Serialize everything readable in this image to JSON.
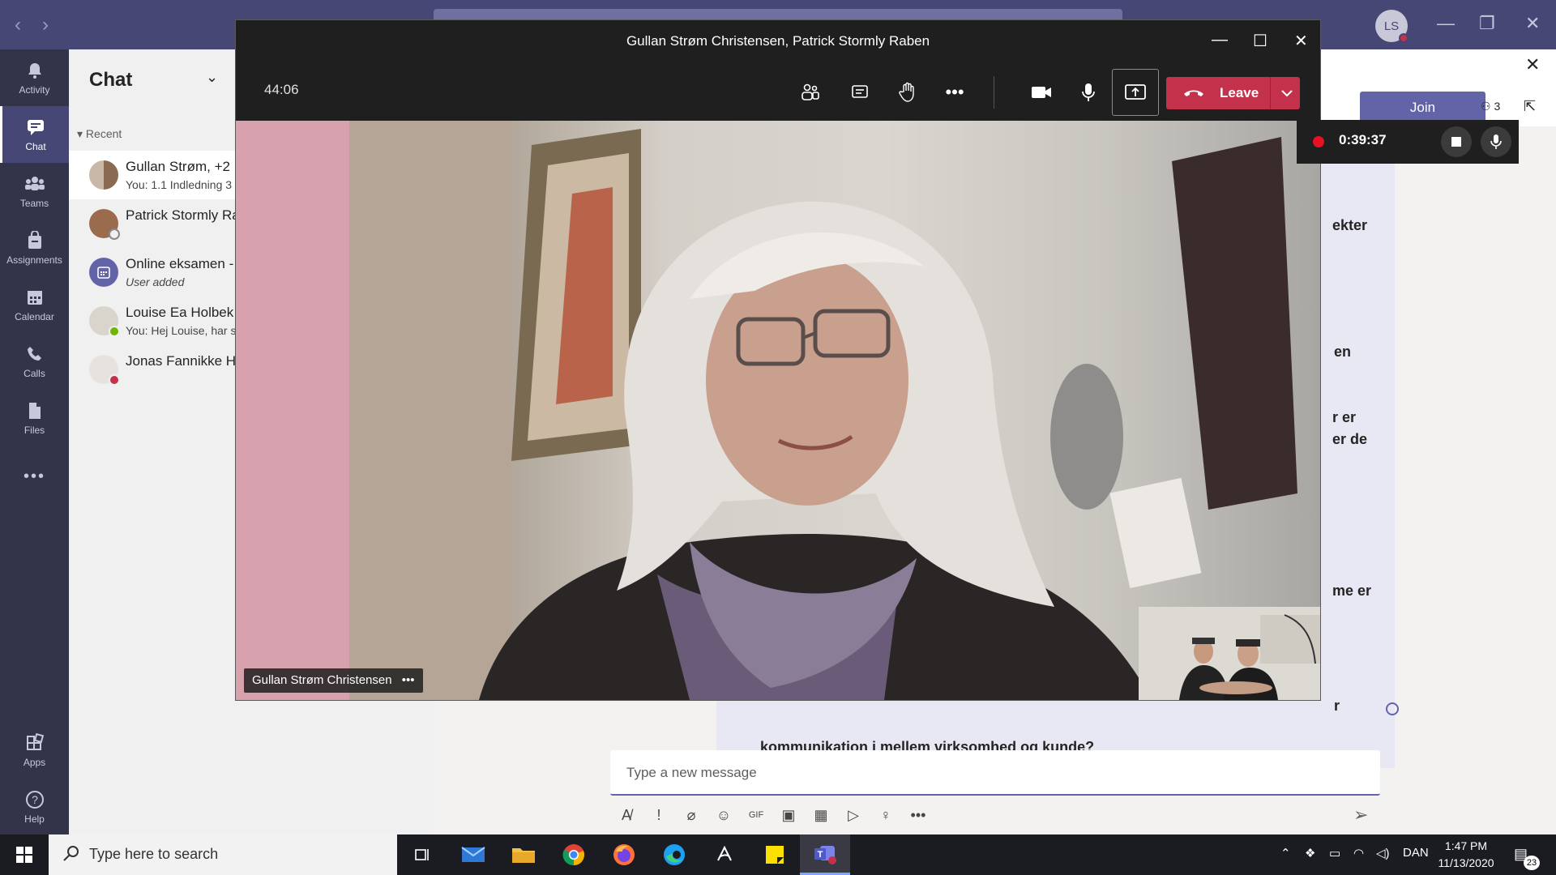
{
  "titlebar": {
    "back": "‹",
    "forward": "›",
    "avatar_initials": "LS",
    "minimize": "—",
    "restore": "❐",
    "close": "✕"
  },
  "rail": [
    {
      "id": "activity",
      "label": "Activity",
      "icon": "bell-icon"
    },
    {
      "id": "chat",
      "label": "Chat",
      "icon": "chat-icon",
      "active": true
    },
    {
      "id": "teams",
      "label": "Teams",
      "icon": "teams-icon"
    },
    {
      "id": "assignments",
      "label": "Assignments",
      "icon": "assignments-icon"
    },
    {
      "id": "calendar",
      "label": "Calendar",
      "icon": "calendar-icon"
    },
    {
      "id": "calls",
      "label": "Calls",
      "icon": "phone-icon"
    },
    {
      "id": "files",
      "label": "Files",
      "icon": "file-icon"
    },
    {
      "id": "more",
      "label": "•••",
      "icon": "more-icon"
    },
    {
      "id": "apps",
      "label": "Apps",
      "icon": "apps-icon"
    },
    {
      "id": "help",
      "label": "Help",
      "icon": "help-icon"
    }
  ],
  "chat_list": {
    "title": "Chat",
    "recent_label": "Recent",
    "items": [
      {
        "name": "Gullan Strøm, +2",
        "preview": "You: 1.1 Indledning 3",
        "selected": true,
        "presence": "none"
      },
      {
        "name": "Patrick Stormly Ra",
        "preview": "",
        "presence": "offline"
      },
      {
        "name": "Online eksamen -",
        "preview": "User added",
        "presence": "none",
        "italic": true
      },
      {
        "name": "Louise Ea Holbek",
        "preview": "You: Hej Louise, har s",
        "presence": "available"
      },
      {
        "name": "Jonas Fannikke He",
        "preview": "",
        "presence": "busy"
      }
    ]
  },
  "main": {
    "join_label": "Join",
    "participants_count": "3",
    "message_fragments": [
      "ekter",
      "en",
      "r er",
      "er de",
      "me er",
      "r",
      "kommunikation i mellem virksomhed og kunde?"
    ],
    "compose_placeholder": "Type a new message",
    "toolbar_icons": [
      "format-icon",
      "important-icon",
      "attach-icon",
      "emoji-icon",
      "gif-icon",
      "sticker-icon",
      "schedule-icon",
      "stream-icon",
      "praise-icon",
      "more-icon"
    ]
  },
  "call": {
    "title": "Gullan Strøm Christensen, Patrick Stormly Raben",
    "duration": "44:06",
    "leave_label": "Leave",
    "speaker_label": "Gullan Strøm Christensen",
    "speaker_more": "•••"
  },
  "recording": {
    "elapsed": "0:39:37"
  },
  "taskbar": {
    "search_placeholder": "Type here to search",
    "language": "DAN",
    "time": "1:47 PM",
    "date": "11/13/2020",
    "notifications": "23"
  },
  "colors": {
    "teams_purple": "#464775",
    "rail": "#33344a",
    "leave_red": "#c4314b",
    "join": "#6264a7"
  }
}
